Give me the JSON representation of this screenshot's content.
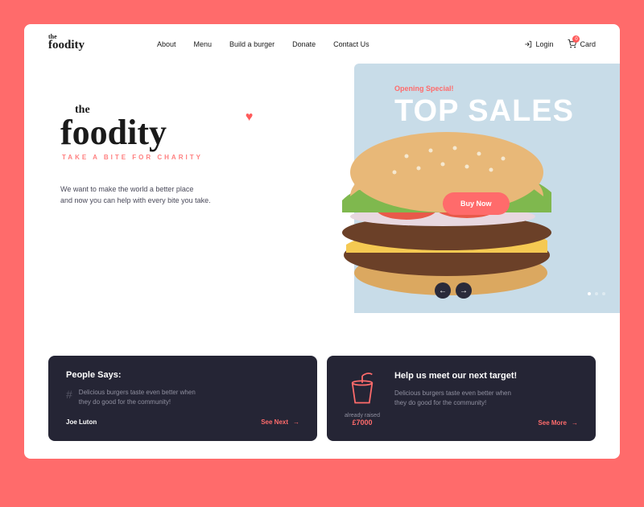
{
  "brand": {
    "the": "the",
    "name": "foodity"
  },
  "nav": {
    "about": "About",
    "menu": "Menu",
    "build": "Build a burger",
    "donate": "Donate",
    "contact": "Contact Us"
  },
  "header": {
    "login": "Login",
    "cart": "Card",
    "cart_count": "0"
  },
  "hero": {
    "the": "the",
    "name": "foodity",
    "tagline": "TAKE A BITE FOR CHARITY",
    "desc1": "We want to make the world a better place",
    "desc2": "and now you can help with every bite you take.",
    "opening": "Opening Special!",
    "top_sales": "TOP SALES",
    "buy": "Buy Now"
  },
  "testimonial": {
    "title": "People Says:",
    "quote1": "Delicious burgers taste even better when",
    "quote2": "they do good for the community!",
    "author": "Joe Luton",
    "see_next": "See Next"
  },
  "target": {
    "raised_label": "already raised",
    "raised_amount": "£7000",
    "title": "Help us meet our next target!",
    "desc1": "Delicious burgers taste even better when",
    "desc2": "they do good for the community!",
    "see_more": "See More"
  }
}
